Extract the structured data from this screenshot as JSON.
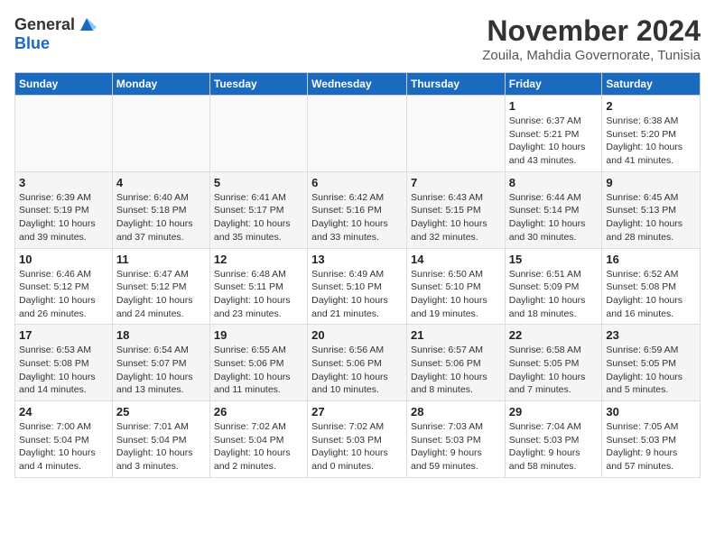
{
  "header": {
    "logo_general": "General",
    "logo_blue": "Blue",
    "month_year": "November 2024",
    "location": "Zouila, Mahdia Governorate, Tunisia"
  },
  "weekdays": [
    "Sunday",
    "Monday",
    "Tuesday",
    "Wednesday",
    "Thursday",
    "Friday",
    "Saturday"
  ],
  "weeks": [
    [
      {
        "day": "",
        "detail": ""
      },
      {
        "day": "",
        "detail": ""
      },
      {
        "day": "",
        "detail": ""
      },
      {
        "day": "",
        "detail": ""
      },
      {
        "day": "",
        "detail": ""
      },
      {
        "day": "1",
        "detail": "Sunrise: 6:37 AM\nSunset: 5:21 PM\nDaylight: 10 hours\nand 43 minutes."
      },
      {
        "day": "2",
        "detail": "Sunrise: 6:38 AM\nSunset: 5:20 PM\nDaylight: 10 hours\nand 41 minutes."
      }
    ],
    [
      {
        "day": "3",
        "detail": "Sunrise: 6:39 AM\nSunset: 5:19 PM\nDaylight: 10 hours\nand 39 minutes."
      },
      {
        "day": "4",
        "detail": "Sunrise: 6:40 AM\nSunset: 5:18 PM\nDaylight: 10 hours\nand 37 minutes."
      },
      {
        "day": "5",
        "detail": "Sunrise: 6:41 AM\nSunset: 5:17 PM\nDaylight: 10 hours\nand 35 minutes."
      },
      {
        "day": "6",
        "detail": "Sunrise: 6:42 AM\nSunset: 5:16 PM\nDaylight: 10 hours\nand 33 minutes."
      },
      {
        "day": "7",
        "detail": "Sunrise: 6:43 AM\nSunset: 5:15 PM\nDaylight: 10 hours\nand 32 minutes."
      },
      {
        "day": "8",
        "detail": "Sunrise: 6:44 AM\nSunset: 5:14 PM\nDaylight: 10 hours\nand 30 minutes."
      },
      {
        "day": "9",
        "detail": "Sunrise: 6:45 AM\nSunset: 5:13 PM\nDaylight: 10 hours\nand 28 minutes."
      }
    ],
    [
      {
        "day": "10",
        "detail": "Sunrise: 6:46 AM\nSunset: 5:12 PM\nDaylight: 10 hours\nand 26 minutes."
      },
      {
        "day": "11",
        "detail": "Sunrise: 6:47 AM\nSunset: 5:12 PM\nDaylight: 10 hours\nand 24 minutes."
      },
      {
        "day": "12",
        "detail": "Sunrise: 6:48 AM\nSunset: 5:11 PM\nDaylight: 10 hours\nand 23 minutes."
      },
      {
        "day": "13",
        "detail": "Sunrise: 6:49 AM\nSunset: 5:10 PM\nDaylight: 10 hours\nand 21 minutes."
      },
      {
        "day": "14",
        "detail": "Sunrise: 6:50 AM\nSunset: 5:10 PM\nDaylight: 10 hours\nand 19 minutes."
      },
      {
        "day": "15",
        "detail": "Sunrise: 6:51 AM\nSunset: 5:09 PM\nDaylight: 10 hours\nand 18 minutes."
      },
      {
        "day": "16",
        "detail": "Sunrise: 6:52 AM\nSunset: 5:08 PM\nDaylight: 10 hours\nand 16 minutes."
      }
    ],
    [
      {
        "day": "17",
        "detail": "Sunrise: 6:53 AM\nSunset: 5:08 PM\nDaylight: 10 hours\nand 14 minutes."
      },
      {
        "day": "18",
        "detail": "Sunrise: 6:54 AM\nSunset: 5:07 PM\nDaylight: 10 hours\nand 13 minutes."
      },
      {
        "day": "19",
        "detail": "Sunrise: 6:55 AM\nSunset: 5:06 PM\nDaylight: 10 hours\nand 11 minutes."
      },
      {
        "day": "20",
        "detail": "Sunrise: 6:56 AM\nSunset: 5:06 PM\nDaylight: 10 hours\nand 10 minutes."
      },
      {
        "day": "21",
        "detail": "Sunrise: 6:57 AM\nSunset: 5:06 PM\nDaylight: 10 hours\nand 8 minutes."
      },
      {
        "day": "22",
        "detail": "Sunrise: 6:58 AM\nSunset: 5:05 PM\nDaylight: 10 hours\nand 7 minutes."
      },
      {
        "day": "23",
        "detail": "Sunrise: 6:59 AM\nSunset: 5:05 PM\nDaylight: 10 hours\nand 5 minutes."
      }
    ],
    [
      {
        "day": "24",
        "detail": "Sunrise: 7:00 AM\nSunset: 5:04 PM\nDaylight: 10 hours\nand 4 minutes."
      },
      {
        "day": "25",
        "detail": "Sunrise: 7:01 AM\nSunset: 5:04 PM\nDaylight: 10 hours\nand 3 minutes."
      },
      {
        "day": "26",
        "detail": "Sunrise: 7:02 AM\nSunset: 5:04 PM\nDaylight: 10 hours\nand 2 minutes."
      },
      {
        "day": "27",
        "detail": "Sunrise: 7:02 AM\nSunset: 5:03 PM\nDaylight: 10 hours\nand 0 minutes."
      },
      {
        "day": "28",
        "detail": "Sunrise: 7:03 AM\nSunset: 5:03 PM\nDaylight: 9 hours\nand 59 minutes."
      },
      {
        "day": "29",
        "detail": "Sunrise: 7:04 AM\nSunset: 5:03 PM\nDaylight: 9 hours\nand 58 minutes."
      },
      {
        "day": "30",
        "detail": "Sunrise: 7:05 AM\nSunset: 5:03 PM\nDaylight: 9 hours\nand 57 minutes."
      }
    ]
  ]
}
